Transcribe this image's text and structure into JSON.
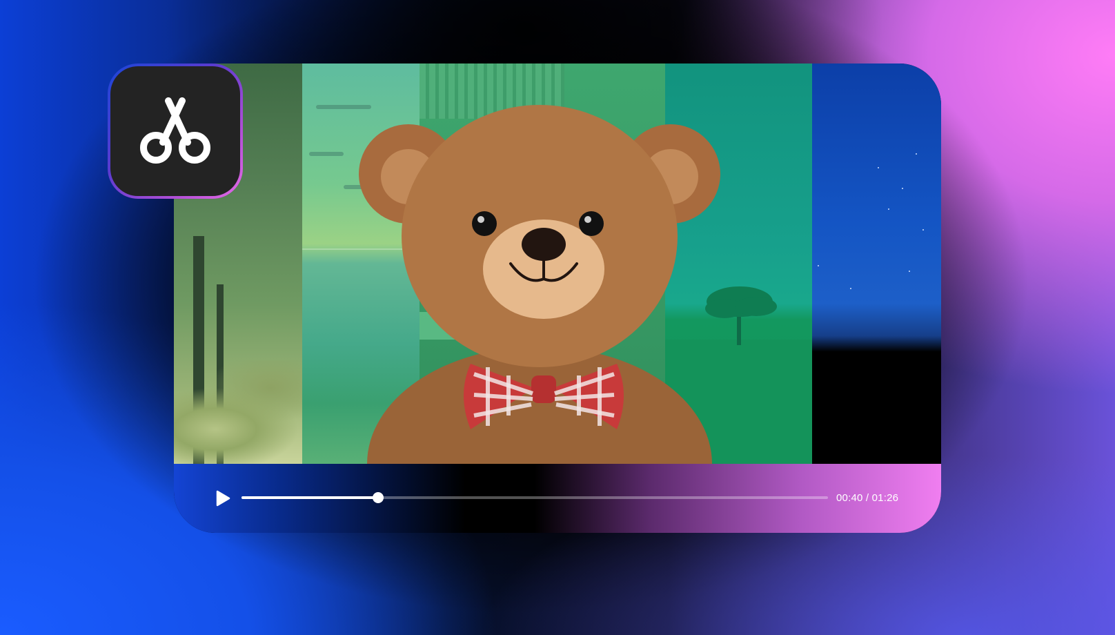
{
  "app_icon": {
    "icon": "scissors-icon"
  },
  "media": {
    "panels": [
      "forest",
      "sea",
      "room",
      "tree",
      "night-sky"
    ],
    "subject": "teddy-bear"
  },
  "player": {
    "play_icon": "play-icon",
    "progress": 0.2325,
    "time_text": "00:40 / 01:26"
  },
  "colors": {
    "accent_blue": "#1a5cff",
    "accent_pink": "#ff7cf6",
    "icon_bg": "#232323"
  }
}
